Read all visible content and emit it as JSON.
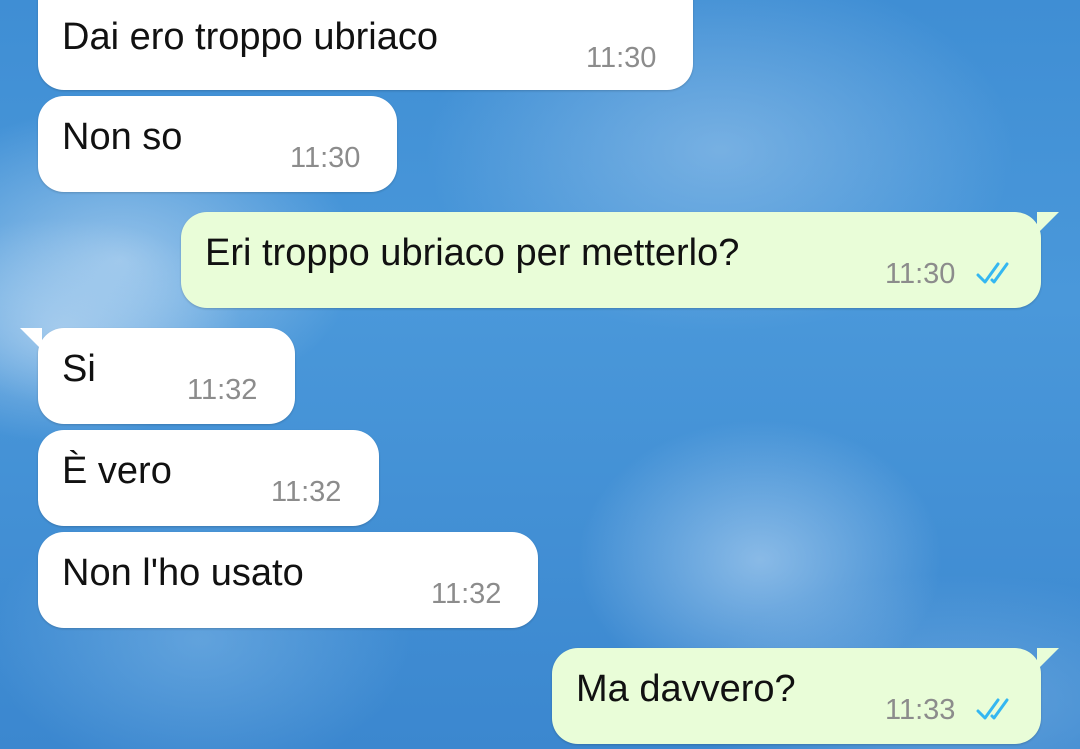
{
  "conversation": {
    "messages": [
      {
        "direction": "incoming",
        "text": "Dai ero troppo ubriaco",
        "time": "11:30"
      },
      {
        "direction": "incoming",
        "text": "Non so",
        "time": "11:30"
      },
      {
        "direction": "outgoing",
        "text": "Eri troppo ubriaco per metterlo?",
        "time": "11:30",
        "status": "read"
      },
      {
        "direction": "incoming",
        "text": "Si",
        "time": "11:32"
      },
      {
        "direction": "incoming",
        "text": "È vero",
        "time": "11:32"
      },
      {
        "direction": "incoming",
        "text": "Non l'ho usato",
        "time": "11:32"
      },
      {
        "direction": "outgoing",
        "text": "Ma davvero?",
        "time": "11:33",
        "status": "read"
      }
    ]
  },
  "icons": {
    "read_receipt": "double-check-icon"
  },
  "colors": {
    "incoming_bubble": "#ffffff",
    "outgoing_bubble": "#e9fdd8",
    "read_tick": "#34b7f1",
    "timestamp": "#8c8c8c"
  }
}
